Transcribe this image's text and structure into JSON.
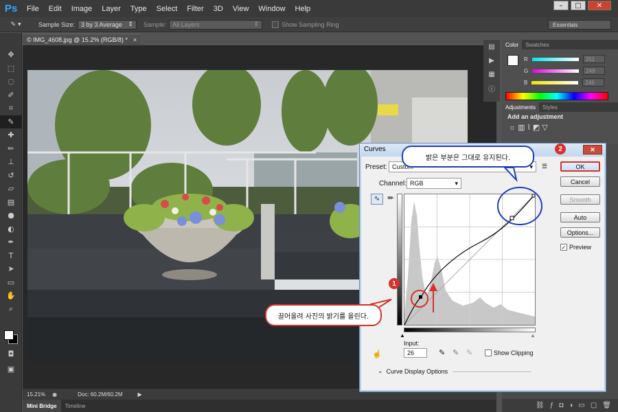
{
  "app": {
    "logo": "Ps"
  },
  "menu": [
    "File",
    "Edit",
    "Image",
    "Layer",
    "Type",
    "Select",
    "Filter",
    "3D",
    "View",
    "Window",
    "Help"
  ],
  "window_buttons": {
    "minimize": "–",
    "maximize": "□",
    "close": "✕"
  },
  "options_bar": {
    "sample_size_label": "Sample Size:",
    "sample_size_value": "3 by 3 Average",
    "sample_label": "Sample:",
    "sample_value": "All Layers",
    "show_ring_label": "Show Sampling Ring",
    "workspace": "Essentials"
  },
  "document": {
    "tab_title": "© IMG_4608.jpg @ 15.2% (RGB/8) *",
    "tab_close": "×",
    "zoom": "15.21%",
    "doc_info": "Doc: 60.2M/60.2M"
  },
  "bottom_tabs": [
    "Mini Bridge",
    "Timeline"
  ],
  "color_panel": {
    "tabs": [
      "Color",
      "Swatches"
    ],
    "channels": [
      {
        "label": "R",
        "value": "251",
        "color": "#00e0e0"
      },
      {
        "label": "G",
        "value": "249",
        "color": "#e000e0"
      },
      {
        "label": "B",
        "value": "246",
        "color": "#e8e800"
      }
    ]
  },
  "adjustments_panel": {
    "tabs": [
      "Adjustments",
      "Styles"
    ],
    "title": "Add an adjustment"
  },
  "curves_dialog": {
    "title": "Curves",
    "close": "✕",
    "preset_label": "Preset:",
    "preset_value": "Custom",
    "channel_label": "Channel:",
    "channel_value": "RGB",
    "buttons": {
      "ok": "OK",
      "cancel": "Cancel",
      "smooth": "Smooth",
      "auto": "Auto",
      "options": "Options..."
    },
    "preview_label": "Preview",
    "input_label": "Input:",
    "input_value": "26",
    "show_clipping_label": "Show Clipping",
    "display_options_label": "Curve Display Options"
  },
  "annotations": {
    "top_note": "밝은 부분은 그대로 유지된다.",
    "bottom_note": "끌어올려 사진의 밝기를 올린다.",
    "badge1": "1",
    "badge2": "2"
  },
  "colors": {
    "annotation_blue": "#1b3cc4",
    "annotation_red": "#d9302a",
    "ps_blue": "#31a8ff"
  }
}
